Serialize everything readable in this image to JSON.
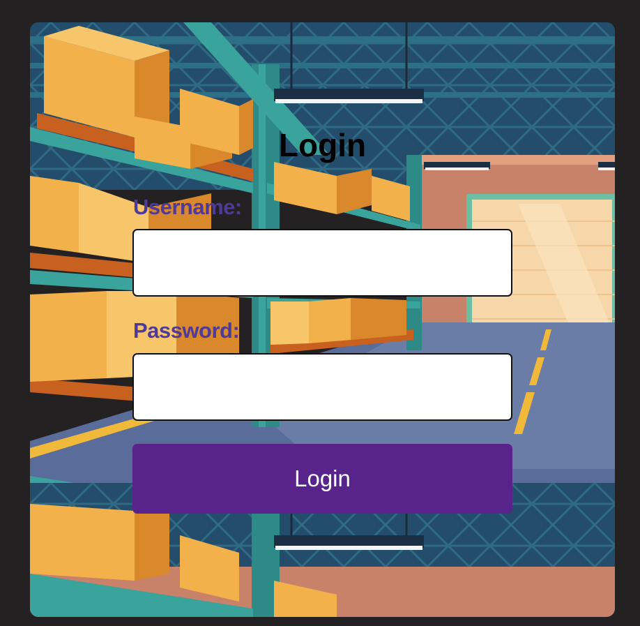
{
  "login_form": {
    "title": "Login",
    "username_label": "Username:",
    "username_value": "",
    "password_label": "Password:",
    "password_value": "",
    "submit_label": "Login"
  },
  "colors": {
    "page_background": "#232122",
    "label_color": "#4f3a97",
    "button_color": "#58238a",
    "button_text": "#ffffff"
  },
  "background_image": {
    "icon": "warehouse-illustration"
  }
}
